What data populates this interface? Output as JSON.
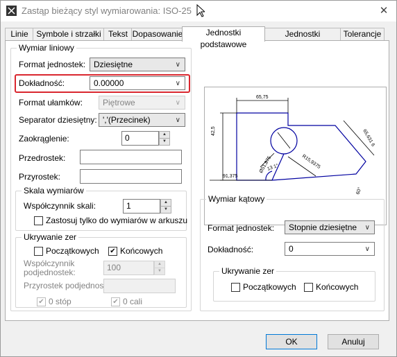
{
  "window": {
    "title": "Zastąp bieżący styl wymiarowania: ISO-25",
    "close": "✕"
  },
  "tabs": [
    "Linie",
    "Symbole i strzałki",
    "Tekst",
    "Dopasowanie",
    "Jednostki podstawowe",
    "Jednostki dodatkowe",
    "Tolerancje"
  ],
  "linear": {
    "group_title": "Wymiar liniowy",
    "format_label": "Format jednostek:",
    "format_value": "Dziesiętne",
    "precision_label": "Dokładność:",
    "precision_value": "0.00000",
    "fraction_label": "Format ułamków:",
    "fraction_value": "Piętrowe",
    "separator_label": "Separator dziesiętny:",
    "separator_value": "','(Przecinek)",
    "round_label": "Zaokrąglenie:",
    "round_value": "0",
    "prefix_label": "Przedrostek:",
    "prefix_value": "",
    "suffix_label": "Przyrostek:",
    "suffix_value": ""
  },
  "scale": {
    "group_title": "Skala wymiarów",
    "factor_label": "Współczynnik skali:",
    "factor_value": "1",
    "layout_only_label": "Zastosuj tylko do wymiarów w arkuszu"
  },
  "zero_linear": {
    "group_title": "Ukrywanie zer",
    "leading": "Początkowych",
    "trailing": "Końcowych",
    "leading_checked": false,
    "trailing_checked": true,
    "subunit_factor_label_1": "Współczynnik",
    "subunit_factor_label_2": "podjednostek:",
    "subunit_factor_value": "100",
    "subunit_suffix_label": "Przyrostek podjednostek:",
    "feet_label": "0 stóp",
    "inches_label": "0 cali"
  },
  "angular": {
    "group_title": "Wymiar kątowy",
    "format_label": "Format jednostek:",
    "format_value": "Stopnie dziesiętne",
    "precision_label": "Dokładność:",
    "precision_value": "0"
  },
  "zero_angular": {
    "group_title": "Ukrywanie zer",
    "leading": "Początkowych",
    "trailing": "Końcowych"
  },
  "preview": {
    "dim_top": "65,75",
    "dim_left": "42,5",
    "dim_right": "65,631 6",
    "dim_bottom": "91,375",
    "dim_dia": "Ø51,875",
    "dim_radius": "R15,9375",
    "dim_angle_1": "13 1°",
    "dim_angle_2": "60°"
  },
  "buttons": {
    "ok": "OK",
    "cancel": "Anuluj"
  },
  "colors": {
    "highlight": "#d9262e",
    "accent": "#0078d7",
    "geometry": "#0000a0"
  }
}
